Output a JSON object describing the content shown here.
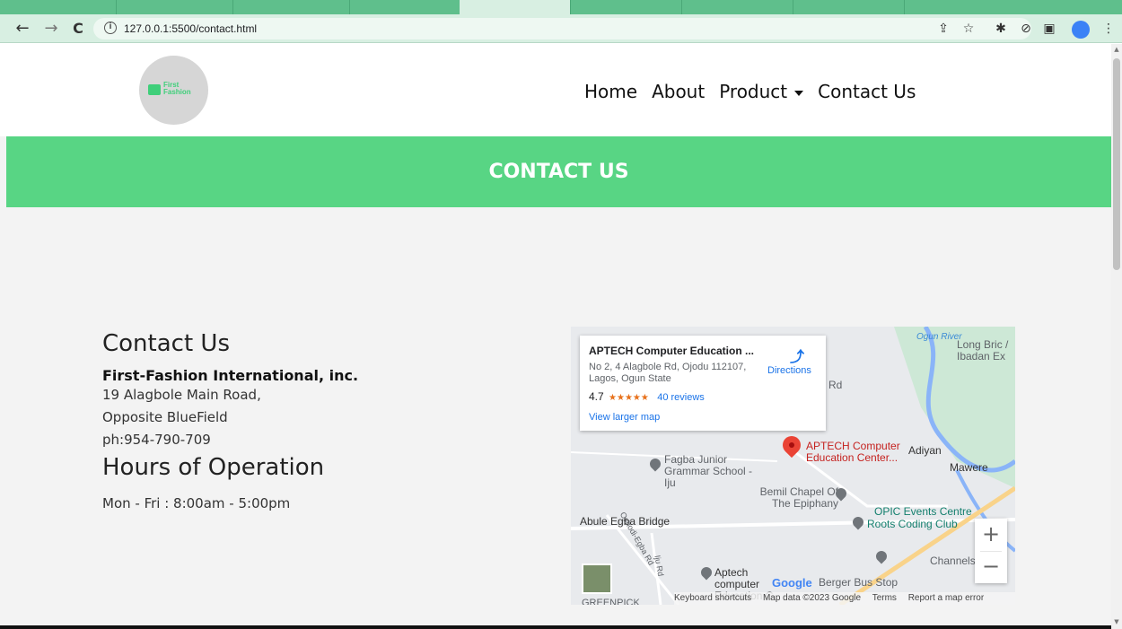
{
  "browser": {
    "url": "127.0.0.1:5500/contact.html",
    "back_icon": "arrow-left-icon",
    "forward_icon": "arrow-right-icon",
    "reload_icon": "reload-icon"
  },
  "site": {
    "logo_text_line1": "First",
    "logo_text_line2": "Fashion",
    "nav": {
      "home": "Home",
      "about": "About",
      "product": "Product",
      "contact": "Contact Us"
    },
    "banner_title": "CONTACT US"
  },
  "contact": {
    "heading": "Contact Us",
    "company": "First-Fashion International, inc.",
    "address_line1": "19 Alagbole Main Road,",
    "address_line2": "Opposite BlueField",
    "phone": "ph:954-790-709",
    "hours_heading": "Hours of Operation",
    "hours": "Mon - Fri : 8:00am - 5:00pm"
  },
  "map": {
    "place_name": "APTECH Computer Education ...",
    "place_address": "No 2, 4 Alagbole Rd, Ojodu 112107, Lagos, Ogun State",
    "rating": "4.7",
    "stars": "★★★★★",
    "reviews": "40 reviews",
    "view_larger": "View larger map",
    "directions": "Directions",
    "pin_label": "APTECH Computer Education Center...",
    "labels": {
      "ogun_river": "Ogun River",
      "long_bridge": "Long Bric / Ibadan Ex",
      "adiyan": "Adiyan",
      "mawere": "Mawere",
      "fagba": "Fagba Junior Grammar School - Iju",
      "bemil": "Bemil Chapel Of The Epiphany",
      "opic": "OPIC Events Centre",
      "roots": "Roots Coding Club",
      "abule": "Abule Egba Bridge",
      "channels": "Channels",
      "aptech2": "Aptech computer Education C",
      "berger": "Berger Bus Stop",
      "greenpick": "GREENPICK",
      "rd": "Rd",
      "oshodi": "Oshodi-Egba Rd",
      "iju_rd": "Iju Rd"
    },
    "zoom_in": "+",
    "zoom_out": "−",
    "google": "Google",
    "attribution": {
      "shortcuts": "Keyboard shortcuts",
      "data": "Map data ©2023 Google",
      "terms": "Terms",
      "report": "Report a map error"
    }
  }
}
